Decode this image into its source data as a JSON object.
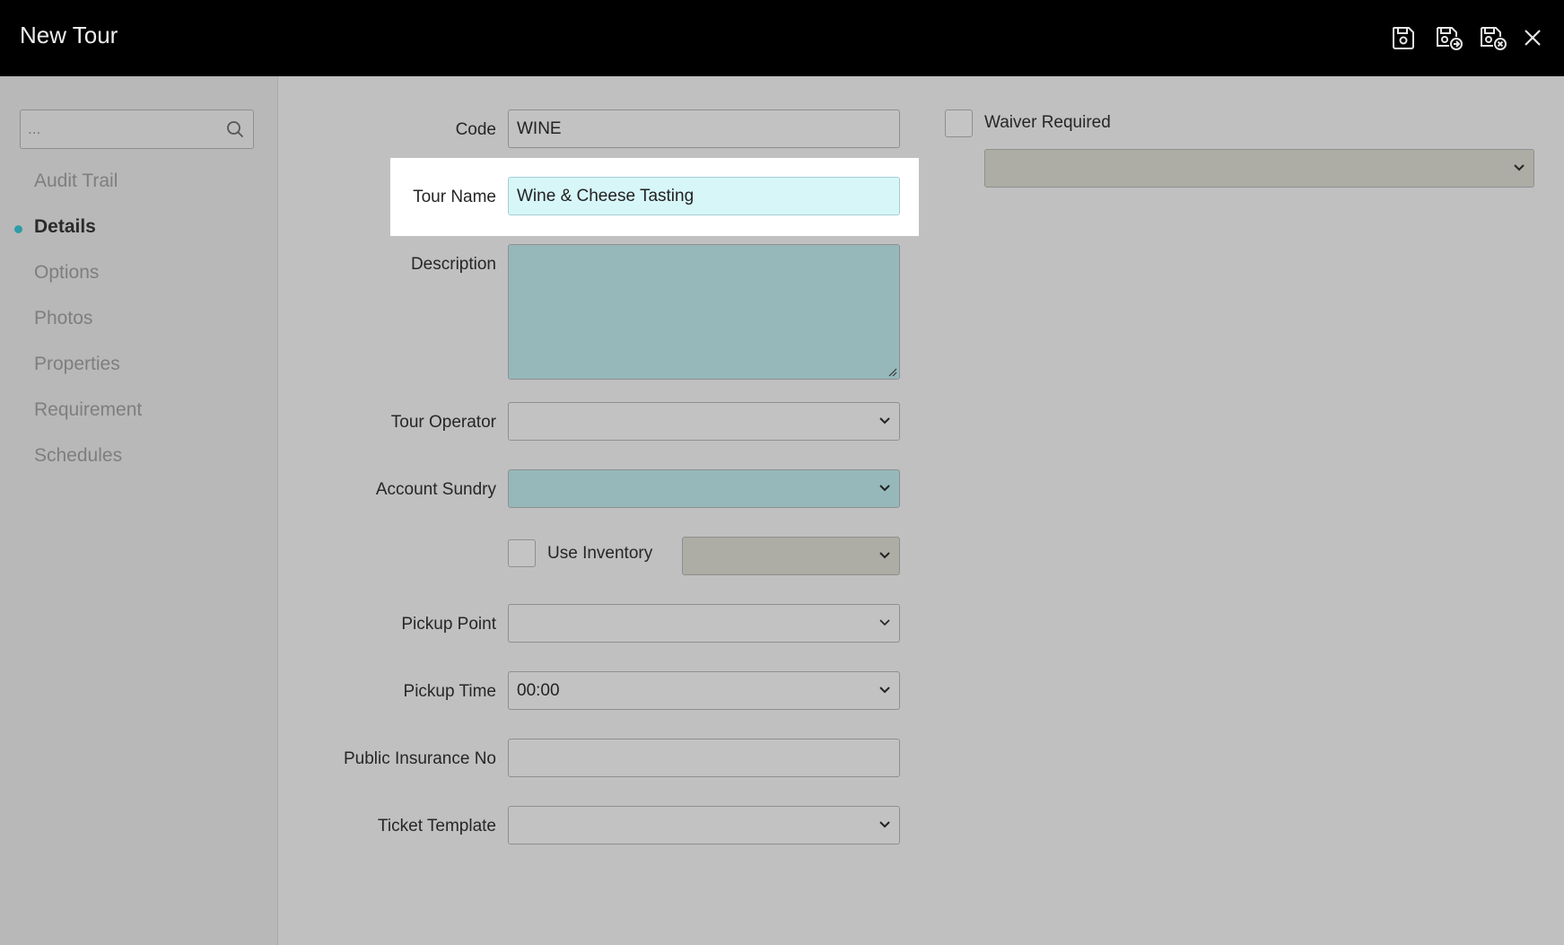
{
  "window": {
    "title": "New Tour",
    "actions": [
      {
        "name": "save-icon",
        "label": "Save"
      },
      {
        "name": "save-and-new-icon",
        "label": "Save and New"
      },
      {
        "name": "save-and-close-icon",
        "label": "Save and Close"
      },
      {
        "name": "close-icon",
        "label": "Close"
      }
    ]
  },
  "sidebar": {
    "search_placeholder": "...",
    "items": [
      {
        "label": "Audit Trail",
        "active": false
      },
      {
        "label": "Details",
        "active": true
      },
      {
        "label": "Options",
        "active": false
      },
      {
        "label": "Photos",
        "active": false
      },
      {
        "label": "Properties",
        "active": false
      },
      {
        "label": "Requirement",
        "active": false
      },
      {
        "label": "Schedules",
        "active": false
      }
    ]
  },
  "form": {
    "code": {
      "label": "Code",
      "value": "WINE"
    },
    "tour_name": {
      "label": "Tour Name",
      "value": "Wine & Cheese Tasting"
    },
    "description": {
      "label": "Description",
      "value": ""
    },
    "tour_operator": {
      "label": "Tour Operator",
      "value": ""
    },
    "account_sundry": {
      "label": "Account Sundry",
      "value": ""
    },
    "use_inventory": {
      "label": "Use Inventory",
      "checked": false,
      "select_value": ""
    },
    "pickup_point": {
      "label": "Pickup Point",
      "value": ""
    },
    "pickup_time": {
      "label": "Pickup Time",
      "value": "00:00"
    },
    "public_insurance_no": {
      "label": "Public Insurance No",
      "value": ""
    },
    "ticket_template": {
      "label": "Ticket Template",
      "value": ""
    },
    "waiver_required": {
      "label": "Waiver Required",
      "checked": false,
      "select_value": ""
    }
  },
  "colors": {
    "accent": "#2e9da8",
    "header": "#000000",
    "background": "#c0c0c0",
    "field_teal": "#96b8bb",
    "field_active": "#d7f6f8"
  }
}
